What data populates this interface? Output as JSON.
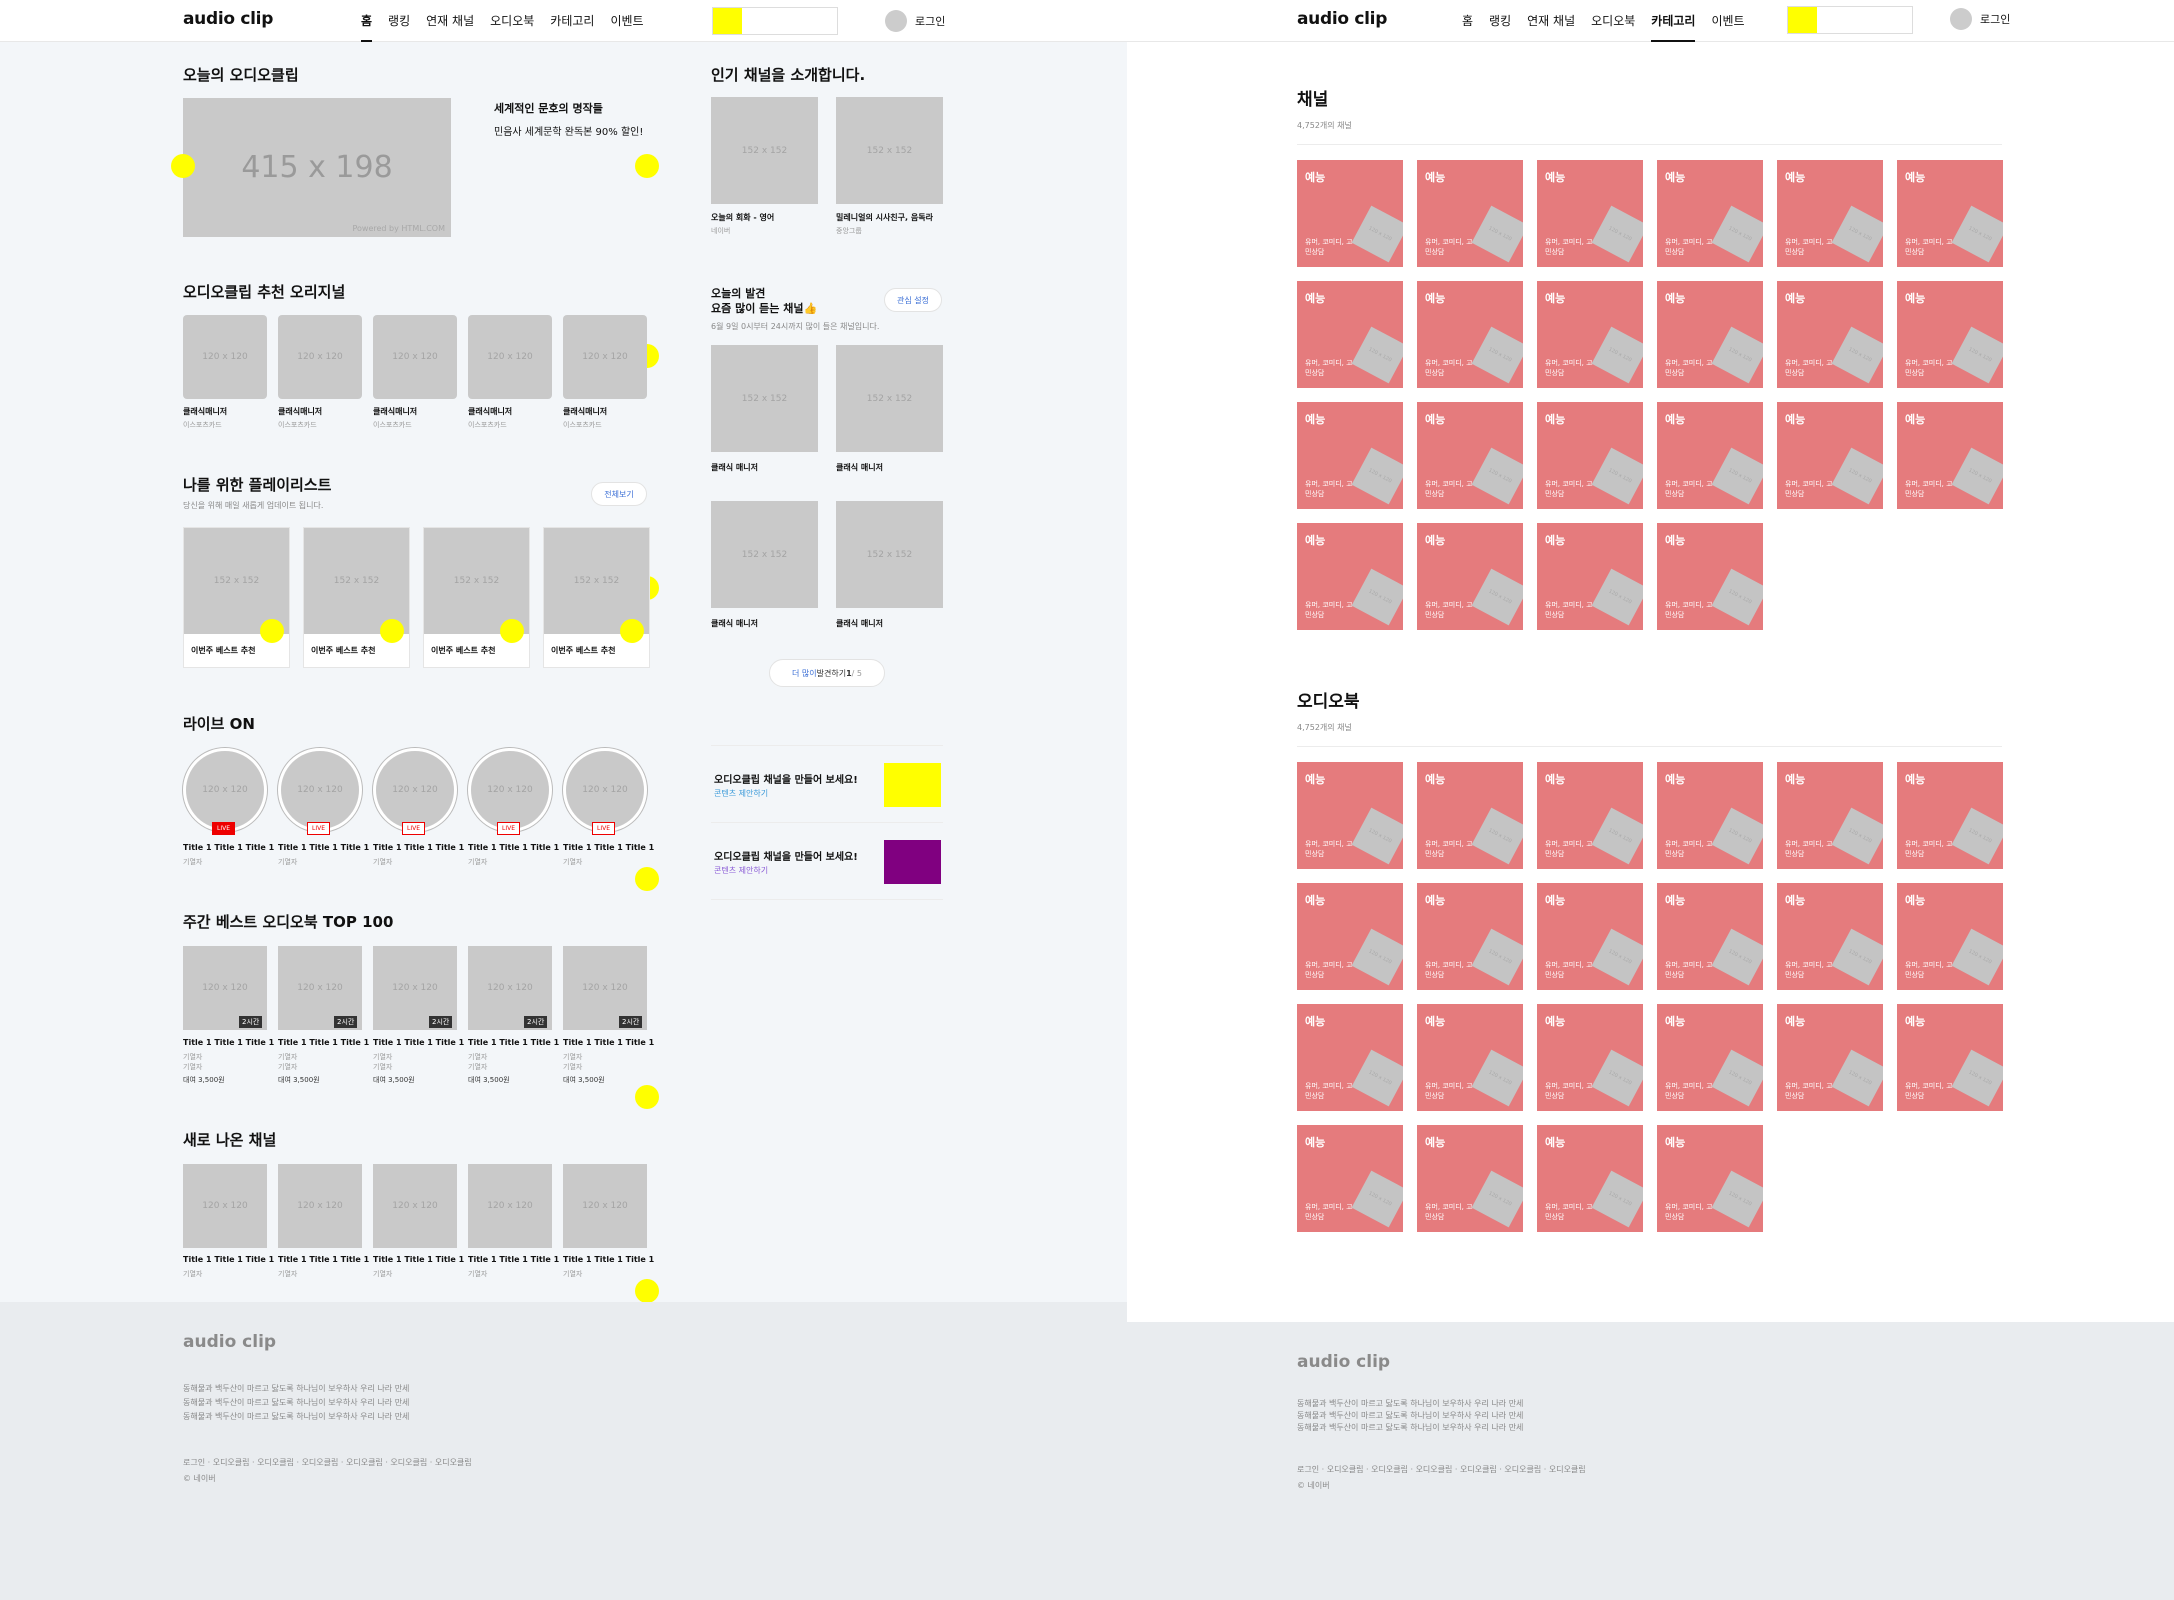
{
  "brand": {
    "logo": "audio clip"
  },
  "nav": {
    "items": [
      "홈",
      "랭킹",
      "연재 채널",
      "오디오북",
      "카테고리",
      "이벤트"
    ],
    "login": "로그인",
    "active_home": 0,
    "active_category": 4
  },
  "colors": {
    "yellow": "#ffff00",
    "purple": "#800080",
    "tile": "#e57b7d",
    "live": "#e00000"
  },
  "main": {
    "today": {
      "title": "오늘의 오디오클립",
      "banner_size": "415 x 198",
      "banner_powered": "Powered by HTML.COM",
      "headline": "세계적인 문호의 명작들",
      "desc": "민음사 세계문학 완독본 90% 할인!"
    },
    "popular": {
      "title": "인기 채널을 소개합니다.",
      "thumb": "152 x 152",
      "items": [
        {
          "name": "오늘의 회화 - 영어",
          "by": "네이버"
        },
        {
          "name": "밀레니얼의 시사친구, 음독라",
          "by": "중앙그룹"
        }
      ]
    },
    "originals": {
      "title": "오디오클립 추천 오리지널",
      "thumb": "120 x 120",
      "items": [
        {
          "name": "클래식매니저",
          "by": "이스포츠카드"
        },
        {
          "name": "클래식매니저",
          "by": "이스포츠카드"
        },
        {
          "name": "클래식매니저",
          "by": "이스포츠카드"
        },
        {
          "name": "클래식매니저",
          "by": "이스포츠카드"
        },
        {
          "name": "클래식매니저",
          "by": "이스포츠카드"
        }
      ]
    },
    "discover": {
      "title1": "오늘의 발견",
      "title2": "요즘 많이 듣는 채널👍",
      "desc": "6월 9일 0시부터 24시까지 많이 들은 채널입니다.",
      "btn": "관심 설정",
      "thumb": "152 x 152",
      "items": [
        "클래식 매니저",
        "클래식 매니저",
        "클래식 매니저",
        "클래식 매니저"
      ],
      "more_pre": "더 많이",
      "more_mid": " 발견하기 ",
      "more_page": "1",
      "more_total": " / 5"
    },
    "playlist": {
      "title": "나를 위한 플레이리스트",
      "desc": "당신을 위해 매일 새롭게 업데이트 됩니다.",
      "btn": "전체보기",
      "thumb": "152 x 152",
      "items": [
        "이번주 베스트 추천",
        "이번주 베스트 추천",
        "이번주 베스트 추천",
        "이번주 베스트 추천"
      ]
    },
    "live": {
      "title": "라이브 ON",
      "thumb": "120 x 120",
      "badge": "LIVE",
      "items": [
        {
          "name": "Title 1 Title 1 Title 1",
          "by": "기열자"
        },
        {
          "name": "Title 1 Title 1 Title 1",
          "by": "기열자"
        },
        {
          "name": "Title 1 Title 1 Title 1",
          "by": "기열자"
        },
        {
          "name": "Title 1 Title 1 Title 1",
          "by": "기열자"
        },
        {
          "name": "Title 1 Title 1 Title 1",
          "by": "기열자"
        }
      ]
    },
    "cta": [
      {
        "title": "오디오클립 채널을 만들어 보세요!",
        "link": "콘텐츠 제안하기"
      },
      {
        "title": "오디오클립 채널을 만들어 보세요!",
        "link": "콘텐츠 제안하기"
      }
    ],
    "weekly": {
      "title": "주간 베스트 오디오북 TOP 100",
      "thumb": "120 x 120",
      "badge": "2시간",
      "items": [
        {
          "name": "Title 1 Title 1 Title 1",
          "by1": "기열자",
          "by2": "기열자",
          "price": "대여 3,500원"
        },
        {
          "name": "Title 1 Title 1 Title 1",
          "by1": "기열자",
          "by2": "기열자",
          "price": "대여 3,500원"
        },
        {
          "name": "Title 1 Title 1 Title 1",
          "by1": "기열자",
          "by2": "기열자",
          "price": "대여 3,500원"
        },
        {
          "name": "Title 1 Title 1 Title 1",
          "by1": "기열자",
          "by2": "기열자",
          "price": "대여 3,500원"
        },
        {
          "name": "Title 1 Title 1 Title 1",
          "by1": "기열자",
          "by2": "기열자",
          "price": "대여 3,500원"
        }
      ]
    },
    "newch": {
      "title": "새로 나온 채널",
      "thumb": "120 x 120",
      "items": [
        {
          "name": "Title 1 Title 1 Title 1",
          "by": "기열자"
        },
        {
          "name": "Title 1 Title 1 Title 1",
          "by": "기열자"
        },
        {
          "name": "Title 1 Title 1 Title 1",
          "by": "기열자"
        },
        {
          "name": "Title 1 Title 1 Title 1",
          "by": "기열자"
        },
        {
          "name": "Title 1 Title 1 Title 1",
          "by": "기열자"
        }
      ]
    }
  },
  "footer": {
    "logo": "audio clip",
    "lines": [
      "동해물과 백두산이 마르고 닳도록 하나님이 보우하사 우리 나라 만세",
      "동해물과 백두산이 마르고 닳도록 하나님이 보우하사 우리 나라 만세",
      "동해물과 백두산이 마르고 닳도록 하나님이 보우하사 우리 나라 만세"
    ],
    "links": "로그인 · 오디오클립 · 오디오클립 · 오디오클립 · 오디오클립 · 오디오클립 · 오디오클립",
    "copy": "© 네이버"
  },
  "category": {
    "channels": {
      "title": "채널",
      "count": "4,752개의 채널"
    },
    "audiobooks": {
      "title": "오디오북",
      "count": "4,752개의 채널"
    },
    "tile": {
      "genre": "예능",
      "desc": "유머, 코미디, 고민상담",
      "thumb": "120 x 120"
    },
    "per_section": 22
  }
}
